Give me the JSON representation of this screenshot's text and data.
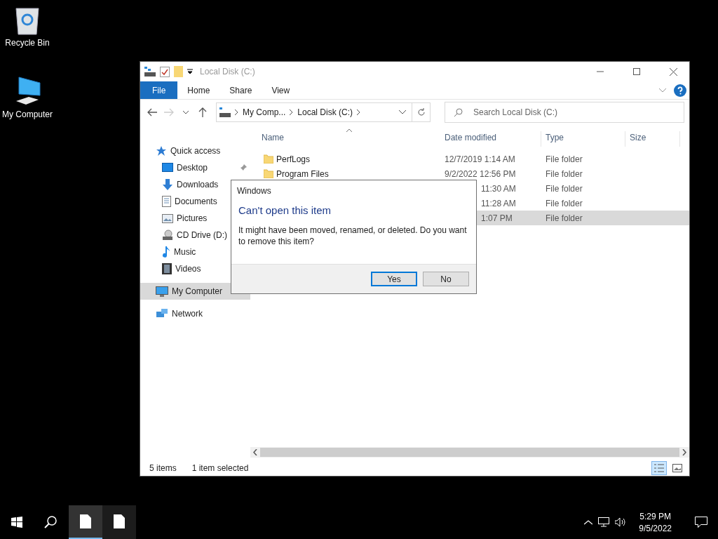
{
  "desktop_icons": [
    {
      "kind": "bin",
      "label": "Recycle Bin"
    },
    {
      "kind": "computer",
      "label": "My Computer"
    }
  ],
  "explorer": {
    "title": "Local Disk (C:)",
    "ribbon_tabs": [
      {
        "kind": "file",
        "label": "File"
      },
      {
        "kind": "tab",
        "label": "Home"
      },
      {
        "kind": "tab",
        "label": "Share"
      },
      {
        "kind": "tab",
        "label": "View"
      }
    ],
    "address": {
      "segments": [
        "My Comp...",
        "Local Disk (C:)"
      ]
    },
    "search": {
      "placeholder": "Search Local Disk (C:)"
    },
    "nav": [
      {
        "kind": "star",
        "label": "Quick access",
        "selected": false,
        "children": [
          {
            "kind": "desktop",
            "label": "Desktop",
            "pinned": true
          },
          {
            "kind": "download",
            "label": "Downloads"
          },
          {
            "kind": "document",
            "label": "Documents"
          },
          {
            "kind": "picture",
            "label": "Pictures"
          },
          {
            "kind": "cd",
            "label": "CD Drive (D:)"
          },
          {
            "kind": "music",
            "label": "Music"
          },
          {
            "kind": "video",
            "label": "Videos"
          }
        ]
      },
      {
        "kind": "computer",
        "label": "My Computer",
        "selected": true
      },
      {
        "kind": "network",
        "label": "Network",
        "selected": false
      }
    ],
    "columns": [
      "Name",
      "Date modified",
      "Type",
      "Size"
    ],
    "rows": [
      {
        "name": "PerfLogs",
        "date": "12/7/2019 1:14 AM",
        "type": "File folder",
        "selected": false,
        "covered": false
      },
      {
        "name": "Program Files",
        "date": "9/2/2022 12:56 PM",
        "type": "File folder",
        "selected": false,
        "covered": false
      },
      {
        "date": "11:30 AM",
        "type": "File folder",
        "selected": false,
        "covered": true
      },
      {
        "date": "11:28 AM",
        "type": "File folder",
        "selected": false,
        "covered": true
      },
      {
        "date": "1:07 PM",
        "type": "File folder",
        "selected": true,
        "covered": true
      }
    ],
    "status": [
      "5 items",
      "1 item selected"
    ]
  },
  "dialog": {
    "title": "Windows",
    "heading": "Can't open this item",
    "message": "It might have been moved, renamed, or deleted. Do you want to remove this item?",
    "buttons": [
      {
        "label": "Yes",
        "default": true
      },
      {
        "label": "No",
        "default": false
      }
    ]
  },
  "taskbar": {
    "apps": [
      {
        "active": true
      },
      {
        "active": false
      }
    ],
    "time": "5:29 PM",
    "date": "9/5/2022"
  }
}
